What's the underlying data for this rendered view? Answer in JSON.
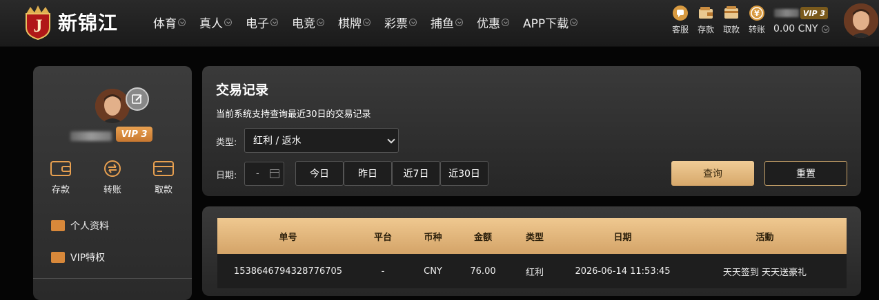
{
  "header": {
    "brand": "新锦江",
    "nav": [
      "体育",
      "真人",
      "电子",
      "电竞",
      "棋牌",
      "彩票",
      "捕鱼",
      "优惠",
      "APP下载"
    ],
    "quick_actions": [
      {
        "label": "客服",
        "icon": "chat-bubble-icon"
      },
      {
        "label": "存款",
        "icon": "wallet-icon"
      },
      {
        "label": "取款",
        "icon": "card-icon"
      },
      {
        "label": "转账",
        "icon": "transfer-coin-icon"
      }
    ],
    "vip": "VIP 3",
    "balance": "0.00 CNY"
  },
  "sidebar": {
    "vip": "VIP 3",
    "actions": [
      {
        "label": "存款",
        "icon": "wallet-icon"
      },
      {
        "label": "转账",
        "icon": "transfer-icon"
      },
      {
        "label": "取款",
        "icon": "card-icon"
      }
    ],
    "menu": [
      {
        "label": "个人资料",
        "icon": "id-card-icon"
      },
      {
        "label": "VIP特权",
        "icon": "id-card-icon"
      }
    ]
  },
  "panel": {
    "title": "交易记录",
    "subtitle": "当前系统支持查询最近30日的交易记录",
    "type_label": "类型:",
    "type_value": "红利 / 返水",
    "date_label": "日期:",
    "date_value": "-",
    "ranges": [
      "今日",
      "昨日",
      "近7日",
      "近30日"
    ],
    "query": "查询",
    "reset": "重置"
  },
  "table": {
    "columns": [
      "单号",
      "平台",
      "币种",
      "金额",
      "类型",
      "日期",
      "活動"
    ],
    "rows": [
      [
        "1538646794328776705",
        "-",
        "CNY",
        "76.00",
        "红利",
        "2026-06-14 11:53:45",
        "天天签到 天天送豪礼"
      ]
    ]
  },
  "colors": {
    "accent": "#d6a76a",
    "vip_badge": "#d88a3a"
  }
}
